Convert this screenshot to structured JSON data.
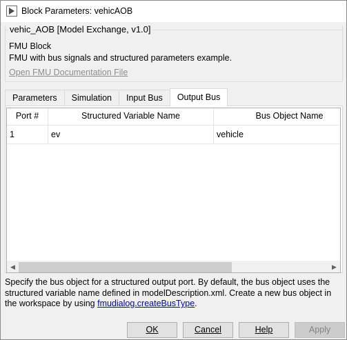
{
  "window": {
    "title": "Block Parameters: vehicAOB",
    "icon": "simulink-block-icon"
  },
  "block_info": {
    "group_title": "vehic_AOB [Model Exchange, v1.0]",
    "block_type": "FMU Block",
    "description": "FMU with bus signals and structured parameters example.",
    "doc_link": "Open FMU Documentation File"
  },
  "tabs": [
    {
      "label": "Parameters",
      "active": false
    },
    {
      "label": "Simulation",
      "active": false
    },
    {
      "label": "Input Bus",
      "active": false
    },
    {
      "label": "Output Bus",
      "active": true
    }
  ],
  "table": {
    "headers": [
      "Port #",
      "Structured Variable Name",
      "Bus Object Name"
    ],
    "rows": [
      [
        "1",
        "ev",
        "vehicle"
      ]
    ]
  },
  "help": {
    "text": "Specify the bus object for a structured output port. By default, the bus object uses the structured variable name defined in modelDescription.xml. Create a new bus object in the workspace by using ",
    "link": "fmudialog.createBusType",
    "suffix": "."
  },
  "buttons": {
    "ok": "OK",
    "cancel": "Cancel",
    "help": "Help",
    "apply": "Apply"
  }
}
